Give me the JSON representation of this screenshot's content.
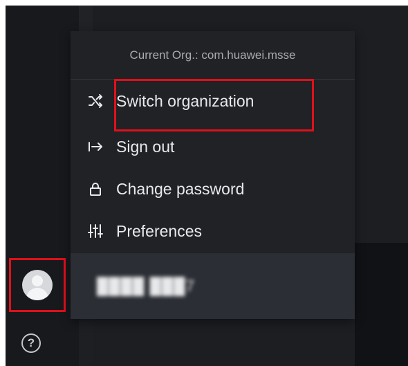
{
  "org": {
    "current_label": "Current Org.: com.huawei.msse"
  },
  "menu": {
    "switch_org": "Switch organization",
    "sign_out": "Sign out",
    "change_password": "Change password",
    "preferences": "Preferences"
  },
  "user": {
    "name": "████ ███7"
  },
  "sidebar": {
    "help_label": "?"
  },
  "icons": {
    "switch": "shuffle-icon",
    "sign_out": "sign-out-icon",
    "password": "lock-icon",
    "preferences": "sliders-icon",
    "avatar": "avatar-icon",
    "help": "help-icon"
  },
  "colors": {
    "highlight": "#e0101a",
    "menu_bg": "#202226",
    "user_row_bg": "#2b2e34",
    "text": "#e8e9eb",
    "muted_text": "#a9abb0"
  }
}
